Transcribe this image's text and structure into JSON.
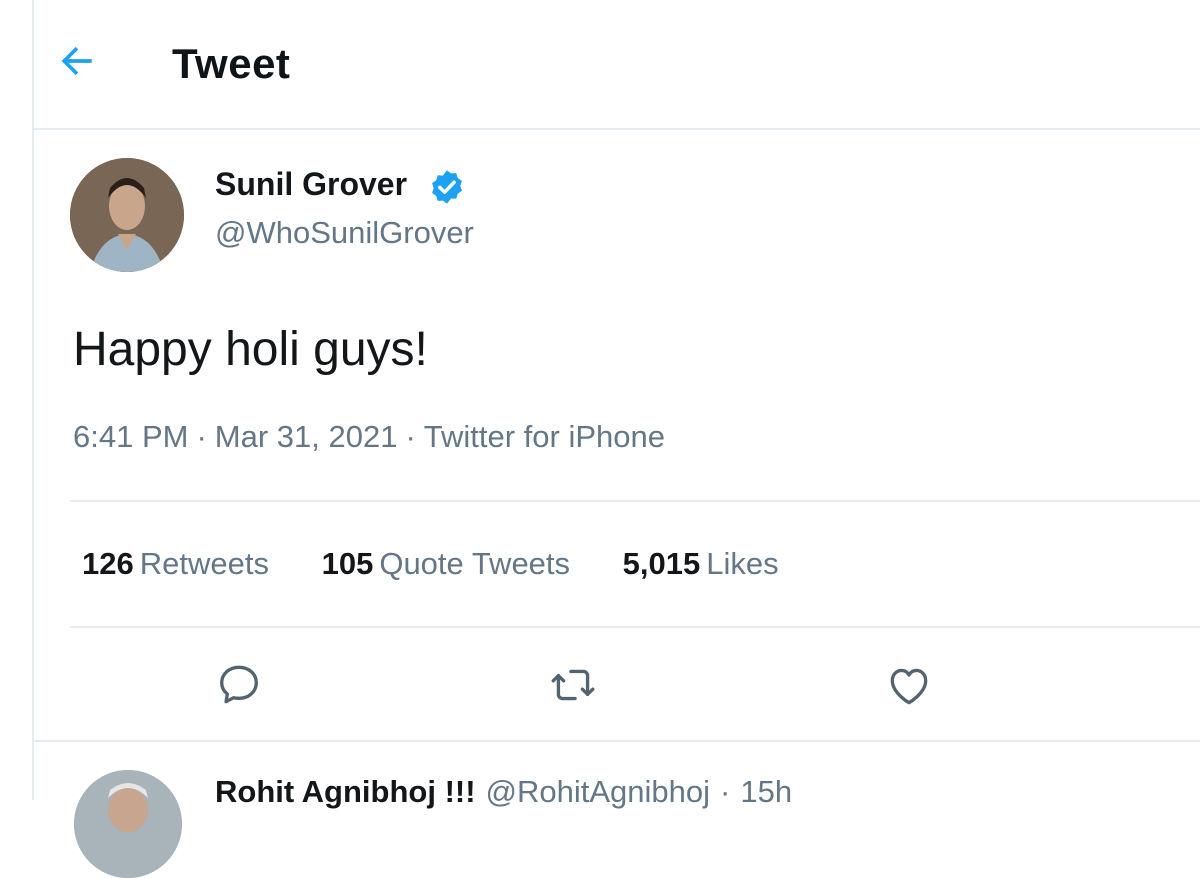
{
  "header": {
    "title": "Tweet",
    "back_icon": "arrow-left-icon"
  },
  "tweet": {
    "author": {
      "name": "Sunil Grover",
      "handle": "@WhoSunilGrover",
      "verified": true
    },
    "text": "Happy holi guys!",
    "time": "6:41 PM",
    "date": "Mar 31, 2021",
    "source": "Twitter for iPhone",
    "separator": "·",
    "stats": {
      "retweets": {
        "count": "126",
        "label": "Retweets"
      },
      "quotes": {
        "count": "105",
        "label": "Quote Tweets"
      },
      "likes": {
        "count": "5,015",
        "label": "Likes"
      }
    },
    "actions": [
      "reply-icon",
      "retweet-icon",
      "like-icon"
    ]
  },
  "reply": {
    "name": "Rohit Agnibhoj !!!",
    "handle": "@RohitAgnibhoj",
    "separator": "·",
    "time": "15h"
  },
  "colors": {
    "accent": "#1da1f2",
    "text": "#14171a",
    "secondary": "#657786",
    "border": "#e6ecf0"
  }
}
